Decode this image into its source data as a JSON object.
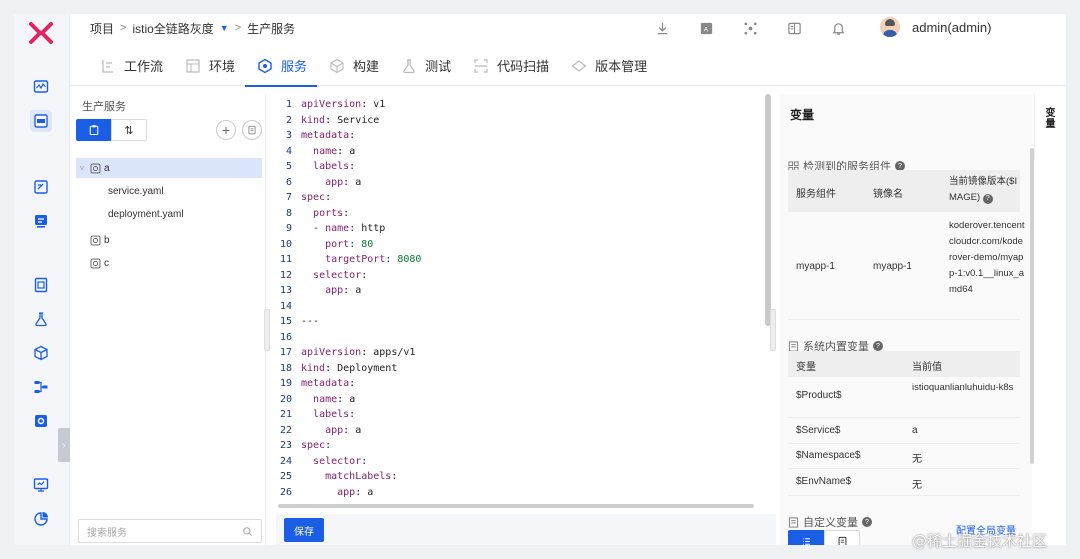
{
  "breadcrumb": {
    "project": "项目",
    "project_name": "istio全链路灰度",
    "page": "生产服务"
  },
  "user": {
    "name": "admin(admin)"
  },
  "tabs": [
    {
      "label": "工作流",
      "icon": "workflow-icon"
    },
    {
      "label": "环境",
      "icon": "environment-icon"
    },
    {
      "label": "服务",
      "icon": "service-icon",
      "active": true
    },
    {
      "label": "构建",
      "icon": "build-icon"
    },
    {
      "label": "测试",
      "icon": "test-icon"
    },
    {
      "label": "代码扫描",
      "icon": "code-scan-icon"
    },
    {
      "label": "版本管理",
      "icon": "version-icon"
    }
  ],
  "tree": {
    "title": "生产服务",
    "nodes": [
      {
        "label": "a",
        "selected": true
      },
      {
        "label": "service.yaml"
      },
      {
        "label": "deployment.yaml"
      },
      {
        "label": "b"
      },
      {
        "label": "c"
      }
    ],
    "search_placeholder": "搜索服务"
  },
  "editor": {
    "lines": [
      "1|apiVersion: v1",
      "2|kind: Service",
      "3|metadata:",
      "4|  name: a",
      "5|  labels:",
      "6|    app: a",
      "7|spec:",
      "8|  ports:",
      "9|  - name: http",
      "10|    port: 80",
      "11|    targetPort: 8080",
      "12|  selector:",
      "13|    app: a",
      "14|",
      "15|---",
      "16|",
      "17|apiVersion: apps/v1",
      "18|kind: Deployment",
      "19|metadata:",
      "20|  name: a",
      "21|  labels:",
      "22|    app: a",
      "23|spec:",
      "24|  selector:",
      "25|    matchLabels:",
      "26|      app: a"
    ],
    "save_label": "保存"
  },
  "vars": {
    "title": "变量",
    "detected": {
      "title": "检测到的服务组件",
      "headers": [
        "服务组件",
        "镜像名",
        "当前镜像版本($IMAGE)"
      ],
      "rows": [
        [
          "myapp-1",
          "myapp-1",
          "koderover.tencentcloudcr.com/koderover-demo/myapp-1:v0.1__linux_amd64"
        ]
      ]
    },
    "system": {
      "title": "系统内置变量",
      "headers": [
        "变量",
        "当前值"
      ],
      "rows": [
        [
          "$Product$",
          "istioquanlianluhuidu-k8s"
        ],
        [
          "$Service$",
          "a"
        ],
        [
          "$Namespace$",
          "无"
        ],
        [
          "$EnvName$",
          "无"
        ]
      ]
    },
    "custom": {
      "title": "自定义变量",
      "global_link": "配置全局变量"
    }
  },
  "side_tab": "变量",
  "watermark": "@稀土掘金技术社区",
  "colors": {
    "primary": "#1a5ee6",
    "brand": "#e0245e"
  }
}
